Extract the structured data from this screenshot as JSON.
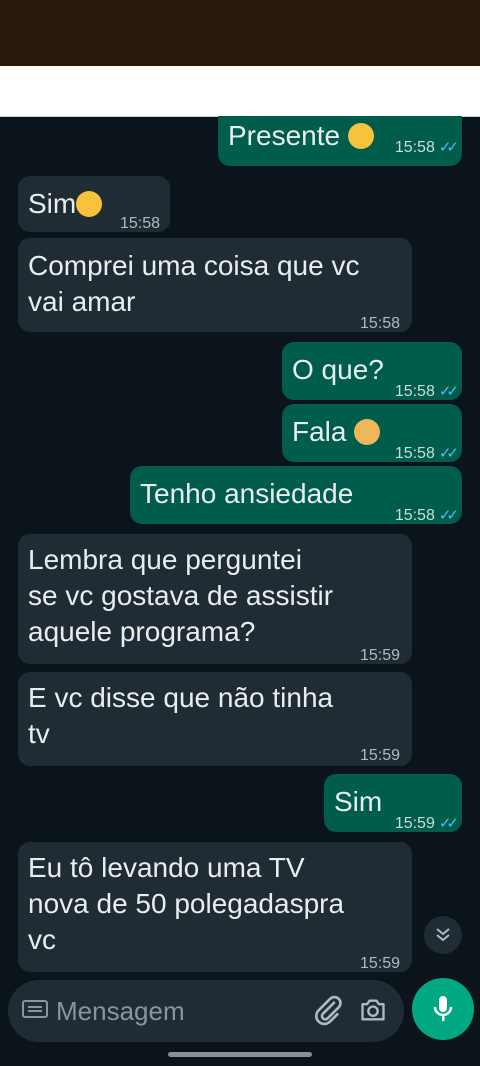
{
  "composer": {
    "placeholder": "Mensagem"
  },
  "messages": [
    {
      "text": "Presente ",
      "time": "15:58"
    },
    {
      "text": "Sim",
      "time": "15:58"
    },
    {
      "text": "Comprei uma coisa que vc\nvai amar",
      "time": "15:58"
    },
    {
      "text": "O que?",
      "time": "15:58"
    },
    {
      "text": "Fala ",
      "time": "15:58"
    },
    {
      "text": "Tenho ansiedade",
      "time": "15:58"
    },
    {
      "text": "Lembra que perguntei\nse vc gostava de assistir\naquele programa?",
      "time": "15:59"
    },
    {
      "text": "E vc disse que não tinha\ntv",
      "time": "15:59"
    },
    {
      "text": "Sim",
      "time": "15:59"
    },
    {
      "text": "Eu tô levando uma TV\nnova de 50 polegadaspra\nvc",
      "time": "15:59"
    }
  ],
  "icons": [
    "keyboard-icon",
    "attach-icon",
    "camera-icon",
    "mic-icon",
    "double-chevron-down-icon",
    "read-check-icon",
    "emoji-icon"
  ],
  "colors": {
    "incoming": "#202c33",
    "outgoing": "#005c4b",
    "accent": "#00a884",
    "read": "#53bdeb"
  }
}
